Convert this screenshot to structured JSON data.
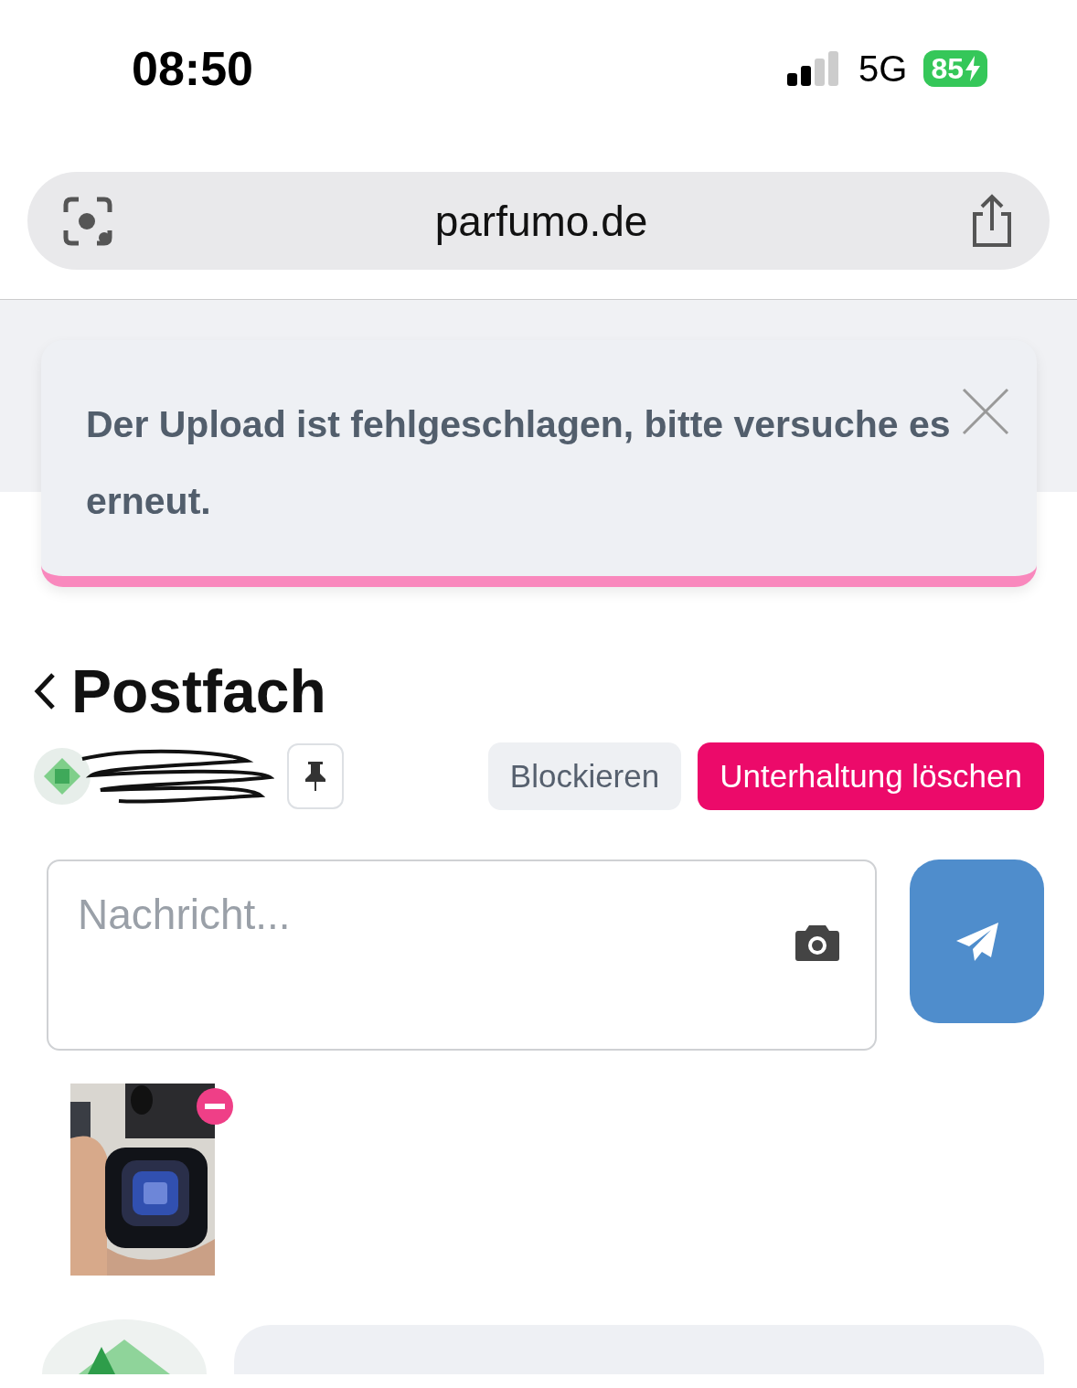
{
  "status_bar": {
    "time": "08:50",
    "network": "5G",
    "battery": "85",
    "charging": true
  },
  "browser": {
    "url": "parfumo.de"
  },
  "toast": {
    "message": "Der Upload ist fehlgeschlagen, bitte versuche es erneut.",
    "kind": "error"
  },
  "page": {
    "back_title": "Postfach",
    "pinned": false,
    "buttons": [
      {
        "label": "Blockieren",
        "kind": "secondary"
      },
      {
        "label": "Unterhaltung löschen",
        "kind": "danger"
      }
    ],
    "composer": {
      "placeholder": "Nachricht..."
    }
  }
}
